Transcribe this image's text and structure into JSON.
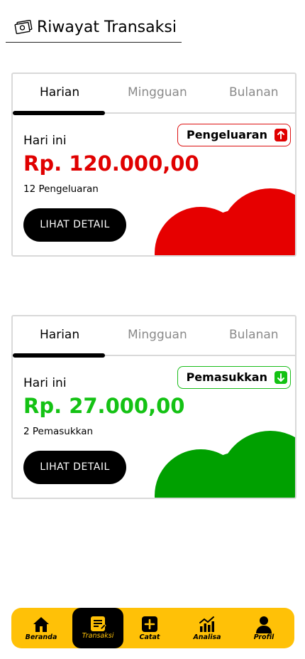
{
  "header": {
    "title": "Riwayat Transaksi",
    "icon": "money-icon"
  },
  "cards": [
    {
      "tabs": [
        "Harian",
        "Mingguan",
        "Bulanan"
      ],
      "active_tab": "Harian",
      "badge": "Pengeluaran",
      "badge_icon": "arrow-up-icon",
      "label": "Hari ini",
      "amount": "Rp. 120.000,00",
      "count": "12 Pengeluaran",
      "button": "LIHAT DETAIL",
      "accent": "#e00000"
    },
    {
      "tabs": [
        "Harian",
        "Mingguan",
        "Bulanan"
      ],
      "active_tab": "Harian",
      "badge": "Pemasukkan",
      "badge_icon": "arrow-down-icon",
      "label": "Hari ini",
      "amount": "Rp. 27.000,00",
      "count": "2 Pemasukkan",
      "button": "LIHAT DETAIL",
      "accent": "#14c214"
    }
  ],
  "nav": {
    "active": "Transaksi",
    "items": [
      {
        "label": "Beranda",
        "icon": "home-icon"
      },
      {
        "label": "Transaksi",
        "icon": "note-icon"
      },
      {
        "label": "Catat",
        "icon": "plus-icon"
      },
      {
        "label": "Analisa",
        "icon": "chart-icon"
      },
      {
        "label": "Profil",
        "icon": "user-icon"
      }
    ],
    "bar_color": "#ffc107"
  }
}
